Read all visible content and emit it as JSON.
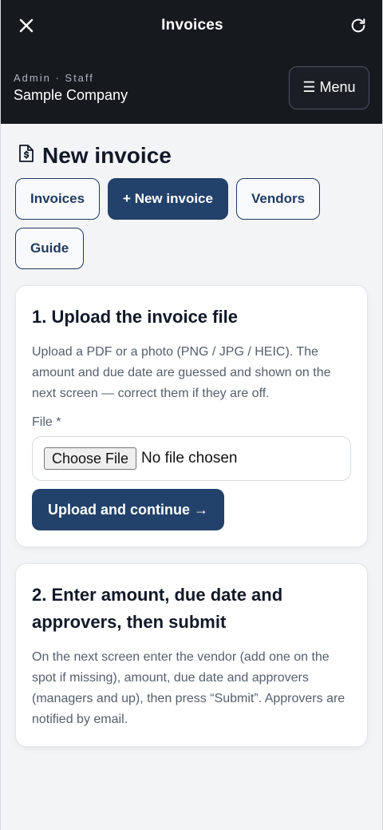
{
  "topbar": {
    "title": "Invoices",
    "close_icon": "close-icon",
    "refresh_icon": "refresh-icon"
  },
  "header": {
    "role": "Admin · Staff",
    "company": "Sample Company",
    "menu_label": "☰ Menu"
  },
  "page": {
    "title": "New invoice",
    "icon": "invoice-file-icon"
  },
  "tabs": [
    {
      "label": "Invoices",
      "active": false
    },
    {
      "label": "+ New invoice",
      "active": true
    },
    {
      "label": "Vendors",
      "active": false
    },
    {
      "label": "Guide",
      "active": false
    }
  ],
  "step1": {
    "title": "1. Upload the invoice file",
    "description": "Upload a PDF or a photo (PNG / JPG / HEIC). The amount and due date are guessed and shown on the next screen — correct them if they are off.",
    "file_label": "File *",
    "choose_label": "Choose File",
    "no_file_text": "No file chosen",
    "submit_label": "Upload and continue →"
  },
  "step2": {
    "title": "2. Enter amount, due date and approvers, then submit",
    "description": "On the next screen enter the vendor (add one on the spot if missing), amount, due date and approvers (managers and up), then press “Submit”. Approvers are notified by email."
  },
  "colors": {
    "dark_bg": "#16191e",
    "primary": "#22416b",
    "page_bg": "#f3f4f6"
  }
}
